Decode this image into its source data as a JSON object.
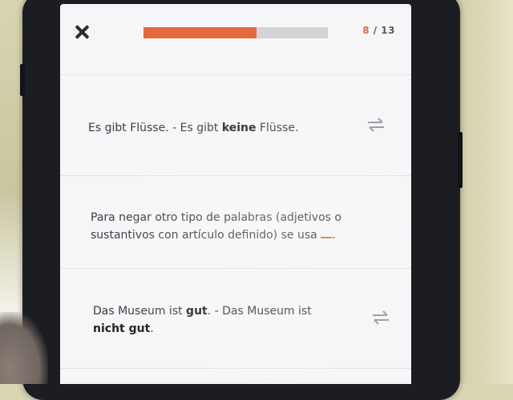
{
  "lesson": {
    "close_icon": "close-icon",
    "progress": {
      "current": "8",
      "separator": " / ",
      "total": "13",
      "fraction": 0.615
    },
    "colors": {
      "accent": "#e36a3f",
      "track": "#d4d3d6",
      "text": "#3b3b40"
    }
  },
  "cards": [
    {
      "parts": [
        "Es gibt Flüsse. - Es gibt ",
        "keine",
        " Flüsse."
      ],
      "action_icon": "swap-arrows-icon"
    },
    {
      "parts": [
        "Para negar otro tipo de palabras (adjetivos o",
        "sustantivos con artículo definido) se usa ",
        "."
      ]
    },
    {
      "parts": [
        "Das Museum ist ",
        "gut",
        ". - Das Museum ist",
        "nicht gut",
        "."
      ],
      "action_icon": "swap-arrows-icon"
    }
  ]
}
